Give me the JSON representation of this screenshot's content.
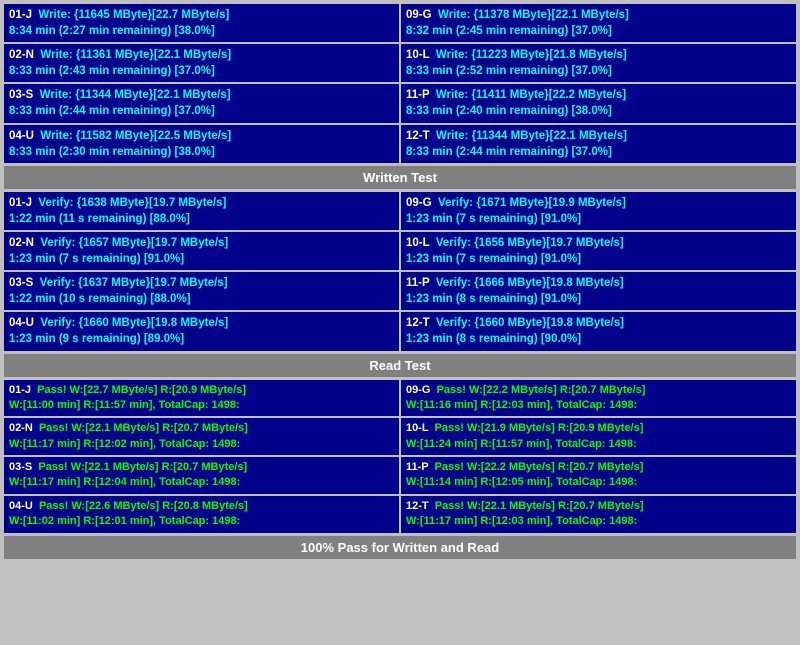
{
  "sections": {
    "write": {
      "rows": [
        {
          "left": {
            "id": "01-J",
            "line1": "Write: {11645 MByte}[22.7 MByte/s]",
            "line2": "8:34 min (2:27 min remaining)  [38.0%]"
          },
          "right": {
            "id": "09-G",
            "line1": "Write: {11378 MByte}[22.1 MByte/s]",
            "line2": "8:32 min (2:45 min remaining)  [37.0%]"
          }
        },
        {
          "left": {
            "id": "02-N",
            "line1": "Write: {11361 MByte}[22.1 MByte/s]",
            "line2": "8:33 min (2:43 min remaining)  [37.0%]"
          },
          "right": {
            "id": "10-L",
            "line1": "Write: {11223 MByte}[21.8 MByte/s]",
            "line2": "8:33 min (2:52 min remaining)  [37.0%]"
          }
        },
        {
          "left": {
            "id": "03-S",
            "line1": "Write: {11344 MByte}[22.1 MByte/s]",
            "line2": "8:33 min (2:44 min remaining)  [37.0%]"
          },
          "right": {
            "id": "11-P",
            "line1": "Write: {11411 MByte}[22.2 MByte/s]",
            "line2": "8:33 min (2:40 min remaining)  [38.0%]"
          }
        },
        {
          "left": {
            "id": "04-U",
            "line1": "Write: {11582 MByte}[22.5 MByte/s]",
            "line2": "8:33 min (2:30 min remaining)  [38.0%]"
          },
          "right": {
            "id": "12-T",
            "line1": "Write: {11344 MByte}[22.1 MByte/s]",
            "line2": "8:33 min (2:44 min remaining)  [37.0%]"
          }
        }
      ]
    },
    "written_label": "Written Test",
    "verify": {
      "rows": [
        {
          "left": {
            "id": "01-J",
            "line1": "Verify: {1638 MByte}[19.7 MByte/s]",
            "line2": "1:22 min (11 s remaining)   [88.0%]"
          },
          "right": {
            "id": "09-G",
            "line1": "Verify: {1671 MByte}[19.9 MByte/s]",
            "line2": "1:23 min (7 s remaining)   [91.0%]"
          }
        },
        {
          "left": {
            "id": "02-N",
            "line1": "Verify: {1657 MByte}[19.7 MByte/s]",
            "line2": "1:23 min (7 s remaining)   [91.0%]"
          },
          "right": {
            "id": "10-L",
            "line1": "Verify: {1656 MByte}[19.7 MByte/s]",
            "line2": "1:23 min (7 s remaining)   [91.0%]"
          }
        },
        {
          "left": {
            "id": "03-S",
            "line1": "Verify: {1637 MByte}[19.7 MByte/s]",
            "line2": "1:22 min (10 s remaining)   [88.0%]"
          },
          "right": {
            "id": "11-P",
            "line1": "Verify: {1666 MByte}[19.8 MByte/s]",
            "line2": "1:23 min (8 s remaining)   [91.0%]"
          }
        },
        {
          "left": {
            "id": "04-U",
            "line1": "Verify: {1660 MByte}[19.8 MByte/s]",
            "line2": "1:23 min (9 s remaining)   [89.0%]"
          },
          "right": {
            "id": "12-T",
            "line1": "Verify: {1660 MByte}[19.8 MByte/s]",
            "line2": "1:23 min (8 s remaining)   [90.0%]"
          }
        }
      ]
    },
    "read_label": "Read Test",
    "pass": {
      "rows": [
        {
          "left": {
            "id": "01-J",
            "line1": "Pass! W:[22.7 MByte/s] R:[20.9 MByte/s]",
            "line2": "W:[11:00 min] R:[11:57 min], TotalCap: 1498:"
          },
          "right": {
            "id": "09-G",
            "line1": "Pass! W:[22.2 MByte/s] R:[20.7 MByte/s]",
            "line2": "W:[11:16 min] R:[12:03 min], TotalCap: 1498:"
          }
        },
        {
          "left": {
            "id": "02-N",
            "line1": "Pass! W:[22.1 MByte/s] R:[20.7 MByte/s]",
            "line2": "W:[11:17 min] R:[12:02 min], TotalCap: 1498:"
          },
          "right": {
            "id": "10-L",
            "line1": "Pass! W:[21.9 MByte/s] R:[20.9 MByte/s]",
            "line2": "W:[11:24 min] R:[11:57 min], TotalCap: 1498:"
          }
        },
        {
          "left": {
            "id": "03-S",
            "line1": "Pass! W:[22.1 MByte/s] R:[20.7 MByte/s]",
            "line2": "W:[11:17 min] R:[12:04 min], TotalCap: 1498:"
          },
          "right": {
            "id": "11-P",
            "line1": "Pass! W:[22.2 MByte/s] R:[20.7 MByte/s]",
            "line2": "W:[11:14 min] R:[12:05 min], TotalCap: 1498:"
          }
        },
        {
          "left": {
            "id": "04-U",
            "line1": "Pass! W:[22.6 MByte/s] R:[20.8 MByte/s]",
            "line2": "W:[11:02 min] R:[12:01 min], TotalCap: 1498:"
          },
          "right": {
            "id": "12-T",
            "line1": "Pass! W:[22.1 MByte/s] R:[20.7 MByte/s]",
            "line2": "W:[11:17 min] R:[12:03 min], TotalCap: 1498:"
          }
        }
      ]
    },
    "footer_label": "100% Pass for Written and Read"
  }
}
